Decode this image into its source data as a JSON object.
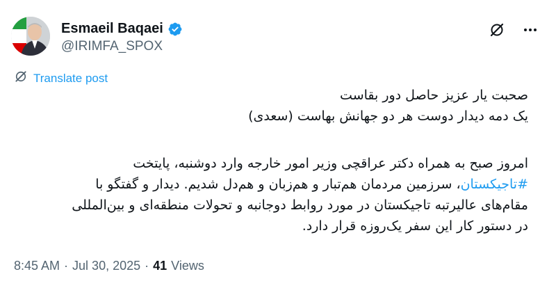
{
  "author": {
    "name": "Esmaeil Baqaei",
    "handle": "@IRIMFA_SPOX",
    "verified_color": "#1d9bf0"
  },
  "actions": {
    "grok_icon": "grok-icon",
    "more_icon": "more-icon"
  },
  "translate": {
    "label": "Translate post",
    "icon": "translate-icon"
  },
  "post": {
    "lines": [
      "صحبت یار عزیز حاصل دور بقاست",
      "یک دمه دیدار دوست هر دو جهانش بهاست (سعدی)",
      "امروز صبح به همراه دکتر عراقچی وزیر امور خارجه وارد دوشنبه، پایتخت",
      "سرزمین مردمان هم‌تبار و هم‌زبان و هم‌دل شدیم. دیدار و گفتگو با",
      "مقام‌های عالیرتبه تاجیکستان در مورد روابط دوجانبه و تحولات منطقه‌ای و بین‌المللی",
      "در دستور کار این سفر یک‌روزه قرار دارد."
    ],
    "hashtag": "#تاجیکستان",
    "hashtag_suffix": "، ",
    "link_color": "#1d9bf0"
  },
  "meta": {
    "time": "8:45 AM",
    "sep": "·",
    "date": "Jul 30, 2025",
    "sep2": "·",
    "views_count": "41",
    "views_label": "Views"
  }
}
